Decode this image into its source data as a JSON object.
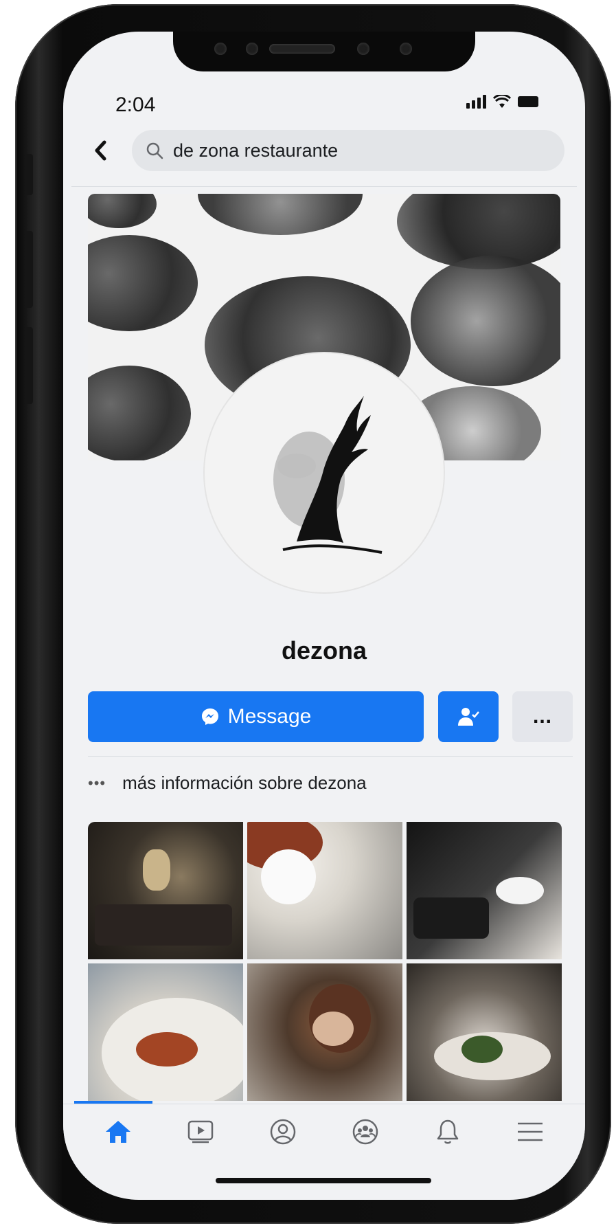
{
  "status_bar": {
    "time": "2:04"
  },
  "search": {
    "query": "de zona restaurante"
  },
  "profile": {
    "name": "dezona",
    "message_button": "Message",
    "more_button": "...",
    "more_info": "más información sobre dezona"
  },
  "tab_bar": {
    "items": [
      "home-icon",
      "watch-icon",
      "profile-icon",
      "groups-icon",
      "notifications-icon",
      "menu-icon"
    ],
    "active": "home"
  },
  "colors": {
    "accent": "#1877f2",
    "background": "#f1f2f4"
  }
}
